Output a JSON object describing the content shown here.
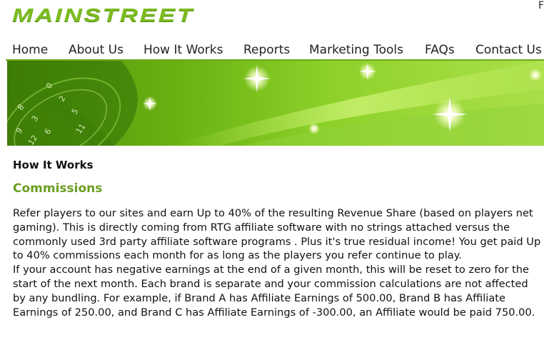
{
  "header": {
    "logo_text": "MAINSTREET",
    "corner_glyph": "F"
  },
  "nav": {
    "items": [
      {
        "label": "Home"
      },
      {
        "label": "About Us"
      },
      {
        "label": "How It Works"
      },
      {
        "label": "Reports"
      },
      {
        "label": "Marketing Tools"
      },
      {
        "label": "FAQs"
      },
      {
        "label": "Contact Us"
      }
    ]
  },
  "colors": {
    "accent": "#7cbb1f",
    "section_heading": "#6a9e1e",
    "banner_dark": "#4e8e08",
    "banner_light": "#a9df48"
  },
  "banner": {
    "roulette_numbers": [
      "0",
      "2",
      "5",
      "8",
      "11",
      "3",
      "6",
      "9",
      "12"
    ]
  },
  "content": {
    "page_title": "How It Works",
    "section_title": "Commissions",
    "paragraph_1": "Refer players to our sites and earn Up to 40% of the resulting Revenue Share (based on players net gaming). This is directly coming from RTG affiliate software with no strings attached versus the commonly used 3rd party affiliate software programs . Plus it's true residual income! You get paid Up to 40% commissions each month for as long as the players you refer continue to play.",
    "paragraph_2": "If your account has negative earnings at the end of a given month, this will be reset to zero for the start of the next month. Each brand is separate and your commission calculations are not affected by any bundling. For example, if Brand A has Affiliate Earnings of 500.00, Brand B has Affiliate Earnings of 250.00, and Brand C has Affiliate Earnings of -300.00, an Affiliate would be paid 750.00."
  }
}
